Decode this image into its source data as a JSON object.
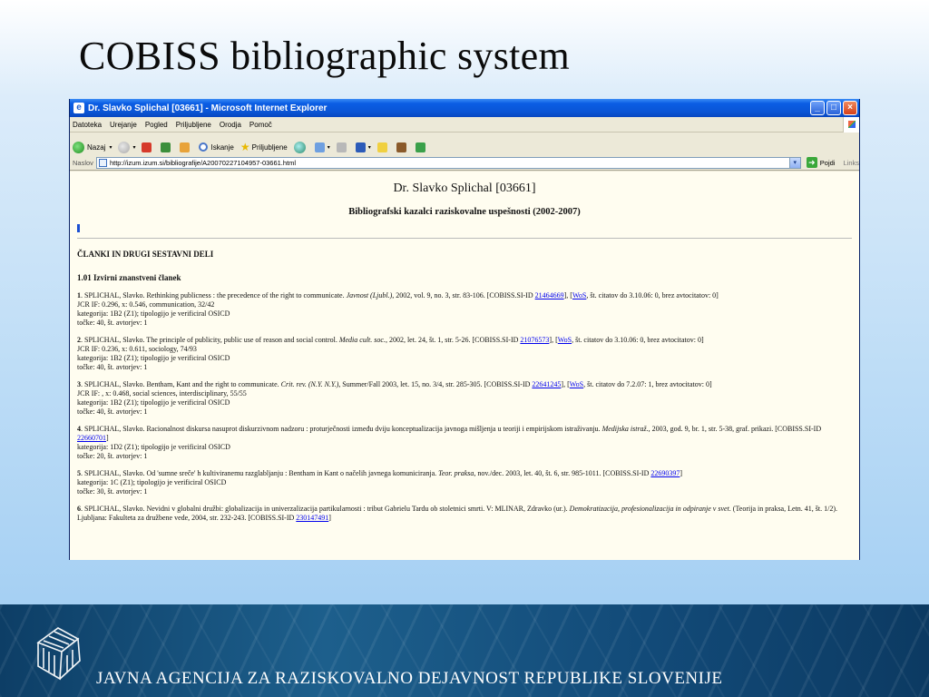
{
  "slide": {
    "title": "COBISS bibliographic system",
    "footer_text": "JAVNA AGENCIJA ZA RAZISKOVALNO DEJAVNOST REPUBLIKE SLOVENIJE"
  },
  "browser": {
    "window_title": "Dr. Slavko Splichal [03661] - Microsoft Internet Explorer",
    "menu": [
      "Datoteka",
      "Urejanje",
      "Pogled",
      "Priljubljene",
      "Orodja",
      "Pomoč"
    ],
    "toolbar": {
      "back_label": "Nazaj",
      "search_label": "Iskanje",
      "favorites_label": "Priljubljene"
    },
    "address": {
      "label": "Naslov",
      "url": "http://izum.izum.si/bibliografije/A20070227104957-03661.html",
      "go_label": "Pojdi",
      "links_label": "Links"
    }
  },
  "document": {
    "title": "Dr. Slavko Splichal [03661]",
    "subtitle": "Bibliografski kazalci raziskovalne uspešnosti (2002-2007)",
    "section": "ČLANKI IN DRUGI SESTAVNI DELI",
    "subsection": "1.01 Izvirni znanstveni članek",
    "entries": [
      {
        "num": "1",
        "lead": ". SPLICHAL, Slavko. Rethinking publicness : the precedence of the right to communicate. ",
        "journal": "Javnost (Ljubl.)",
        "rest": ", 2002, vol. 9, no. 3, str. 83-106. [COBISS.SI-ID ",
        "id": "21464669",
        "wos_pre": "], [",
        "wos": "WoS",
        "tail": ", št. citatov do 3.10.06: 0, brez avtocitatov: 0]",
        "lines": [
          "JCR IF: 0.296, x: 0.546, communication, 32/42",
          "kategorija: 1B2 (Z1); tipologijo je verificiral OSICD",
          "točke: 40, št. avtorjev: 1"
        ]
      },
      {
        "num": "2",
        "lead": ". SPLICHAL, Slavko. The principle of publicity, public use of reason and social control. ",
        "journal": "Media cult. soc.",
        "rest": ", 2002, let. 24, št. 1, str. 5-26. [COBISS.SI-ID ",
        "id": "21076573",
        "wos_pre": "], [",
        "wos": "WoS",
        "tail": ", št. citatov do 3.10.06: 0, brez avtocitatov: 0]",
        "lines": [
          "JCR IF: 0.236, x: 0.611, sociology, 74/93",
          "kategorija: 1B2 (Z1); tipologijo je verificiral OSICD",
          "točke: 40, št. avtorjev: 1"
        ]
      },
      {
        "num": "3",
        "lead": ". SPLICHAL, Slavko. Bentham, Kant and the right to communicate. ",
        "journal": "Crit. rev. (N.Y. N.Y.)",
        "rest": ", Summer/Fall 2003, let. 15, no. 3/4, str. 285-305. [COBISS.SI-ID ",
        "id": "22641245",
        "wos_pre": "], [",
        "wos": "WoS",
        "tail": ", št. citatov do 7.2.07: 1, brez avtocitatov: 0]",
        "lines": [
          "JCR IF: , x: 0.468, social sciences, interdisciplinary, 55/55",
          "kategorija: 1B2 (Z1); tipologijo je verificiral OSICD",
          "točke: 40, št. avtorjev: 1"
        ]
      },
      {
        "num": "4",
        "lead": ". SPLICHAL, Slavko. Racionalnost diskursa nasuprot diskurzivnom nadzoru : proturječnosti između dviju konceptualizacija javnoga mišljenja u teoriji i empirijskom istraživanju. ",
        "journal": "Medijska istraž.",
        "rest": ", 2003, god. 9, br. 1, str. 5-38, graf. prikazi. [COBISS.SI-ID ",
        "id": "22660701",
        "wos_pre": "]",
        "wos": "",
        "tail": "",
        "lines": [
          "kategorija: 1D2 (Z1); tipologijo je verificiral OSICD",
          "točke: 20, št. avtorjev: 1"
        ]
      },
      {
        "num": "5",
        "lead": ". SPLICHAL, Slavko. Od 'sumne sreče' h kultiviranemu razglabljanju : Bentham in Kant o načelih javnega komuniciranja. ",
        "journal": "Teor. praksa",
        "rest": ", nov./dec. 2003, let. 40, št. 6, str. 985-1011. [COBISS.SI-ID ",
        "id": "22690397",
        "wos_pre": "]",
        "wos": "",
        "tail": "",
        "lines": [
          "kategorija: 1C (Z1); tipologijo je verificiral OSICD",
          "točke: 30, št. avtorjev: 1"
        ]
      },
      {
        "num": "6",
        "lead": ". SPLICHAL, Slavko. Nevidni v globalni družbi: globalizacija in univerzalizacija partikularnosti : tribut Gabrielu Tardu ob stoletnici smrti. V: MLINAR, Zdravko (ur.). ",
        "journal": "Demokratizacija, profesionalizacija in odpiranje v svet",
        "rest": ". (Teorija in praksa, Letn. 41, št. 1/2). Ljubljana: Fakulteta za družbene vede, 2004, str. 232-243. [COBISS.SI-ID ",
        "id": "230147491",
        "wos_pre": "]",
        "wos": "",
        "tail": "",
        "lines": []
      }
    ]
  }
}
